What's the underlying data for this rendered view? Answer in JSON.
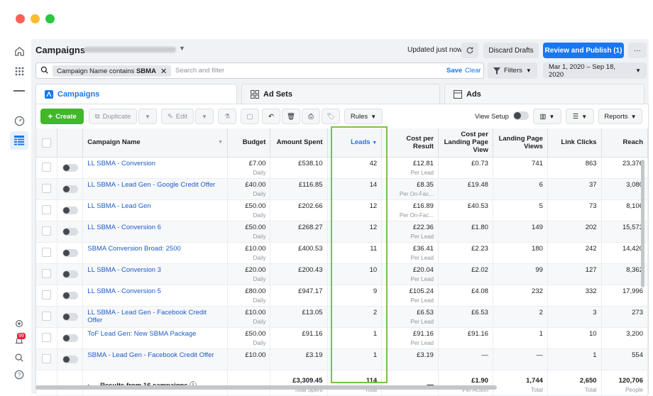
{
  "header": {
    "title": "Campaigns",
    "updated": "Updated just now",
    "discard": "Discard Drafts",
    "review": "Review and Publish (1)",
    "more": "···"
  },
  "filter": {
    "chip_prefix": "Campaign Name contains",
    "chip_term": "SBMA",
    "placeholder": "Search and filter",
    "save": "Save",
    "clear": "Clear",
    "filters": "Filters",
    "date_range": "Mar 1, 2020 – Sep 18, 2020"
  },
  "tabs": [
    "Campaigns",
    "Ad Sets",
    "Ads"
  ],
  "toolbar": {
    "create": "Create",
    "duplicate": "Duplicate",
    "edit": "Edit",
    "rules": "Rules",
    "view_setup": "View Setup",
    "reports": "Reports"
  },
  "columns": {
    "name": "Campaign Name",
    "budget": "Budget",
    "spent": "Amount Spent",
    "leads": "Leads",
    "cpr": "Cost per Result",
    "cplp": "Cost per Landing Page View",
    "lpv": "Landing Page Views",
    "clicks": "Link Clicks",
    "reach": "Reach"
  },
  "rows": [
    {
      "name": "LL SBMA - Conversion",
      "budget": "£7.00",
      "budget_sub": "Daily",
      "spent": "£538.10",
      "leads": "42",
      "cpr": "£12.81",
      "cpr_sub": "Per Lead",
      "cplp": "£0.73",
      "lpv": "741",
      "clicks": "863",
      "reach": "23,376"
    },
    {
      "name": "LL SBMA - Lead Gen - Google Credit Offer",
      "budget": "£40.00",
      "budget_sub": "Daily",
      "spent": "£116.85",
      "leads": "14",
      "cpr": "£8.35",
      "cpr_sub": "Per On-Fac...",
      "cplp": "£19.48",
      "lpv": "6",
      "clicks": "37",
      "reach": "3,080"
    },
    {
      "name": "LL SBMA - Lead Gen",
      "budget": "£50.00",
      "budget_sub": "Daily",
      "spent": "£202.66",
      "leads": "12",
      "cpr": "£16.89",
      "cpr_sub": "Per On-Fac...",
      "cplp": "£40.53",
      "lpv": "5",
      "clicks": "73",
      "reach": "8,106"
    },
    {
      "name": "LL SBMA - Conversion 6",
      "budget": "£50.00",
      "budget_sub": "Daily",
      "spent": "£268.27",
      "leads": "12",
      "cpr": "£22.36",
      "cpr_sub": "Per Lead",
      "cplp": "£1.80",
      "lpv": "149",
      "clicks": "202",
      "reach": "15,573"
    },
    {
      "name": "SBMA Conversion Broad: 2500",
      "budget": "£10.00",
      "budget_sub": "Daily",
      "spent": "£400.53",
      "leads": "11",
      "cpr": "£36.41",
      "cpr_sub": "Per Lead",
      "cplp": "£2.23",
      "lpv": "180",
      "clicks": "242",
      "reach": "14,420"
    },
    {
      "name": "LL SBMA - Conversion 3",
      "budget": "£20.00",
      "budget_sub": "Daily",
      "spent": "£200.43",
      "leads": "10",
      "cpr": "£20.04",
      "cpr_sub": "Per Lead",
      "cplp": "£2.02",
      "lpv": "99",
      "clicks": "127",
      "reach": "8,362"
    },
    {
      "name": "LL SBMA - Conversion 5",
      "budget": "£80.00",
      "budget_sub": "Daily",
      "spent": "£947.17",
      "leads": "9",
      "cpr": "£105.24",
      "cpr_sub": "Per Lead",
      "cplp": "£4.08",
      "lpv": "232",
      "clicks": "332",
      "reach": "17,996"
    },
    {
      "name": "LL SBMA - Lead Gen - Facebook Credit Offer",
      "budget": "£10.00",
      "budget_sub": "Daily",
      "spent": "£13.05",
      "leads": "2",
      "cpr": "£6.53",
      "cpr_sub": "Per Lead",
      "cplp": "£6.53",
      "lpv": "2",
      "clicks": "3",
      "reach": "273"
    },
    {
      "name": "ToF Lead Gen: New SBMA Package",
      "budget": "£50.00",
      "budget_sub": "Daily",
      "spent": "£91.16",
      "leads": "1",
      "cpr": "£91.16",
      "cpr_sub": "Per Lead",
      "cplp": "£91.16",
      "lpv": "1",
      "clicks": "10",
      "reach": "3,200"
    },
    {
      "name": "SBMA - Lead Gen - Facebook Credit Offer",
      "budget": "£10.00",
      "budget_sub": "",
      "spent": "£3.19",
      "leads": "1",
      "cpr": "£3.19",
      "cpr_sub": "",
      "cplp": "—",
      "lpv": "—",
      "clicks": "1",
      "reach": "554"
    }
  ],
  "totals": {
    "label": "Results from 16 campaigns",
    "spent": "£3,309.45",
    "spent_sub": "Total Spent",
    "leads": "114",
    "leads_sub": "Total",
    "cpr": "—",
    "cplp": "£1.90",
    "cplp_sub": "Per Action",
    "lpv": "1,744",
    "lpv_sub": "Total",
    "clicks": "2,650",
    "clicks_sub": "Total",
    "reach": "120,706",
    "reach_sub": "People"
  },
  "notifications_count": "99"
}
